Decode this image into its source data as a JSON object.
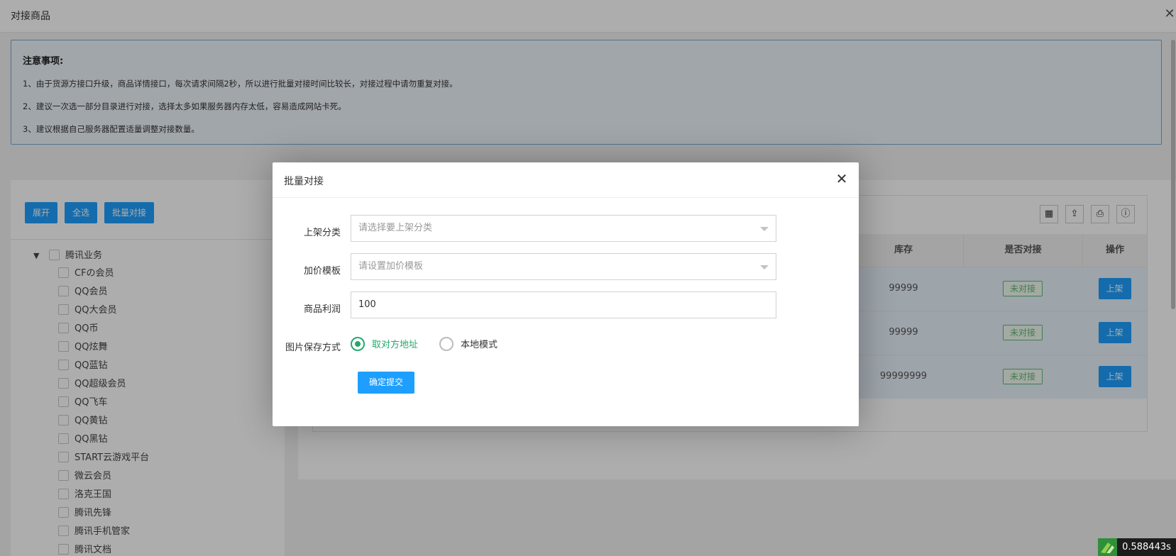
{
  "page": {
    "title": "对接商品",
    "close_glyph": "✕"
  },
  "notice": {
    "title": "注意事项:",
    "lines": [
      "1、由于货源方接口升级，商品详情接口，每次请求间隔2秒，所以进行批量对接时间比较长，对接过程中请勿重复对接。",
      "2、建议一次选一部分目录进行对接，选择太多如果服务器内存太低，容易造成网站卡死。",
      "3、建议根据自己服务器配置适量调整对接数量。"
    ]
  },
  "toolbar": {
    "expand_label": "展开",
    "select_all_label": "全选",
    "batch_label": "批量对接"
  },
  "tree": {
    "root": {
      "arrow": "▼",
      "label": "腾讯业务"
    },
    "items": [
      "CFの会员",
      "QQ会员",
      "QQ大会员",
      "QQ币",
      "QQ炫舞",
      "QQ蓝钻",
      "QQ超级会员",
      "QQ飞车",
      "QQ黄钻",
      "QQ黑钻",
      "START云游戏平台",
      "微云会员",
      "洛克王国",
      "腾讯先锋",
      "腾讯手机管家",
      "腾讯文档"
    ]
  },
  "table": {
    "tool_icons": [
      "columns-icon",
      "export-icon",
      "print-icon",
      "info-icon"
    ],
    "tool_glyphs": [
      "▦",
      "⇪",
      "⎙",
      "ⓘ"
    ],
    "headers": {
      "stock": "库存",
      "linked": "是否对接",
      "action": "操作"
    },
    "rows": [
      {
        "stock": "99999",
        "status": "未对接",
        "action": "上架"
      },
      {
        "stock": "99999",
        "status": "未对接",
        "action": "上架"
      },
      {
        "stock": "99999999",
        "status": "未对接",
        "action": "上架"
      }
    ]
  },
  "modal": {
    "title": "批量对接",
    "close_glyph": "✕",
    "category_label": "上架分类",
    "category_placeholder": "请选择要上架分类",
    "template_label": "加价模板",
    "template_placeholder": "请设置加价模板",
    "profit_label": "商品利润",
    "profit_value": "100",
    "image_label": "图片保存方式",
    "radio_remote": "取对方地址",
    "radio_local": "本地模式",
    "radio_selected": "取对方地址",
    "submit_label": "确定提交"
  },
  "perf": {
    "value": "0.588443s"
  },
  "colors": {
    "primary": "#1e9fff",
    "success": "#5fb878",
    "radio_on": "#22a96b"
  }
}
